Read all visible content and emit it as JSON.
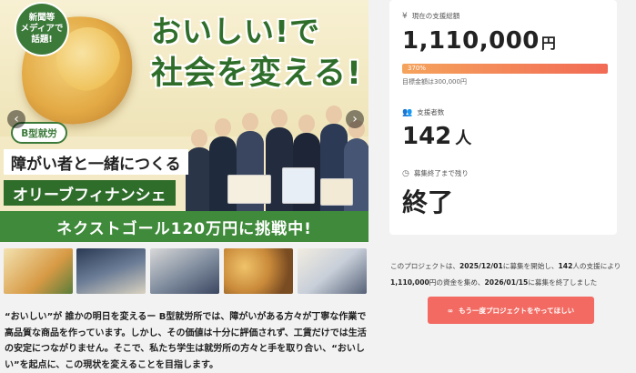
{
  "hero": {
    "badge_lines": [
      "新聞等",
      "メディアで",
      "話題!"
    ],
    "title_line1": "おいしい!で",
    "title_line2": "社会を変える!",
    "tag": "B型就労",
    "line3": "障がい者と一緒につくる",
    "line4": "オリーブフィナンシェ",
    "goal_banner": "ネクストゴール120万円に挑戦中!",
    "prev_arrow": "‹",
    "next_arrow": "›"
  },
  "thumbnails": [
    {
      "text": ""
    },
    {
      "text": ""
    },
    {
      "text": ""
    },
    {
      "text": ""
    },
    {
      "text": ""
    }
  ],
  "description": "“おいしい”が 誰かの明日を変えるー B型就労所では、障がいがある方々が丁寧な作業で高品質な商品を作っています。しかし、その価値は十分に評価されず、工賃だけでは生活の安定につながりません。そこで、私たち学生は就労所の方々と手を取り合い、“おいしい”を起点に、この現状を変えることを目指します。",
  "stats": {
    "amount_label": "現在の支援総額",
    "amount_value": "1,110,000",
    "amount_unit": "円",
    "progress_text": "370%",
    "progress_percent": 370,
    "goal_note": "目標金額は300,000円",
    "supporters_label": "支援者数",
    "supporters_value": "142",
    "supporters_unit": "人",
    "remaining_label": "募集終了まで残り",
    "remaining_value": "終了"
  },
  "summary": {
    "prefix": "このプロジェクトは、",
    "start_date": "2025/12/01",
    "mid1": "に募集を開始し、",
    "supporters": "142",
    "mid2": "人の支援により",
    "amount": "1,110,000",
    "mid3": "円の資金を集め、",
    "end_date": "2026/01/15",
    "suffix": "に募集を終了しました"
  },
  "again_button": {
    "icon": "∞",
    "label": "もう一度プロジェクトをやってほしい"
  },
  "colors": {
    "brand_green": "#2f6d2b",
    "accent_red": "#f26a62",
    "progress_start": "#f5a35c",
    "progress_end": "#f26a55"
  }
}
